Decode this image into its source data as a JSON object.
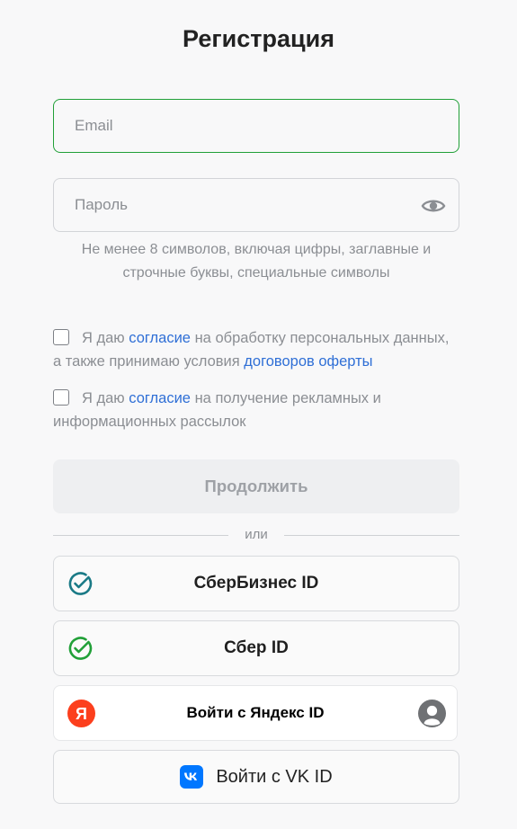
{
  "title": "Регистрация",
  "email": {
    "placeholder": "Email"
  },
  "password": {
    "placeholder": "Пароль",
    "icon": "eye-icon"
  },
  "password_hint": "Не менее 8 символов, включая цифры, заглавные и строчные буквы, специальные символы",
  "consents": [
    {
      "checked": false,
      "before": "Я даю ",
      "link1": "согласие",
      "middle": " на обработку персональных данных, а также принимаю условия ",
      "link2": "договоров оферты"
    },
    {
      "checked": false,
      "before": "Я даю ",
      "link1": "согласие",
      "middle": " на получение рекламных и информационных рассылок"
    }
  ],
  "continue_label": "Продолжить",
  "divider_text": "или",
  "sso": {
    "sber_business": {
      "label": "СберБизнес ID",
      "icon": "sber-check-icon",
      "color": "#1a7a86"
    },
    "sber": {
      "label": "Сбер ID",
      "icon": "sber-check-icon",
      "color": "#21a038"
    },
    "yandex": {
      "label": "Войти с Яндекс ID",
      "icon": "yandex-icon",
      "icon_letter": "Я",
      "color": "#fc3f1d"
    },
    "vk": {
      "label": "Войти с VK ID",
      "icon": "vk-icon",
      "color": "#0077ff"
    }
  },
  "colors": {
    "accent_green": "#21a038",
    "link": "#2f6fd6",
    "muted_text": "#8b8e93"
  }
}
